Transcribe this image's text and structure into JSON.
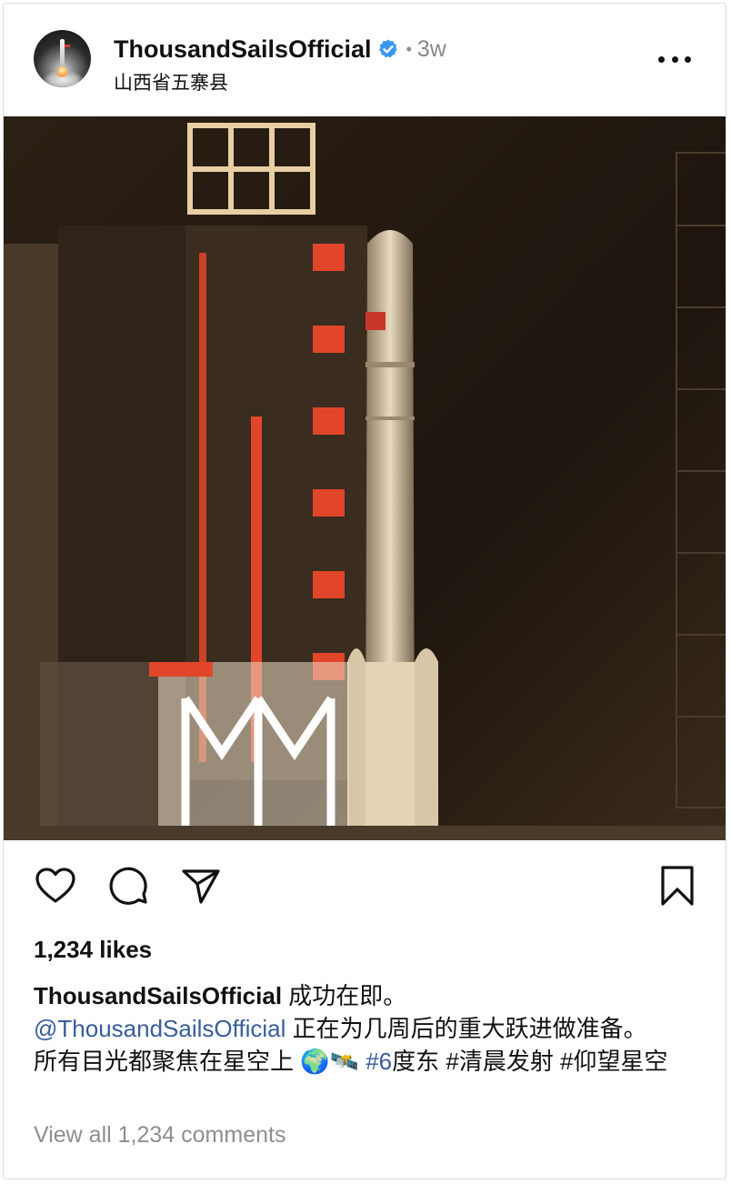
{
  "post": {
    "username": "ThousandSailsOfficial",
    "dot": "•",
    "age": "3w",
    "location": "山西省五寨县",
    "more_icon": "more-horizontal-icon",
    "verified_icon": "verified-badge-icon",
    "verified_color": "#3897f0",
    "image_alt": "Rocket on launch pad with service tower at night"
  },
  "actions": {
    "like_icon": "heart-icon",
    "comment_icon": "comment-icon",
    "share_icon": "send-icon",
    "save_icon": "bookmark-icon"
  },
  "likes": "1,234 likes",
  "caption": {
    "username": "ThousandSailsOfficial",
    "line1": " 成功在即。",
    "mention": "@ThousandSailsOfficial",
    "line2": " 正在为几周后的重大跃进做准备。",
    "line3": "所有目光都聚焦在星空上 ",
    "emoji1": "🌍",
    "emoji2": "🛰️",
    "tag1": " #6",
    "tag_rest": "度东 #清晨发射 #仰望星空",
    "link_color": "#385d9a"
  },
  "comments_link": "View all 1,234 comments"
}
